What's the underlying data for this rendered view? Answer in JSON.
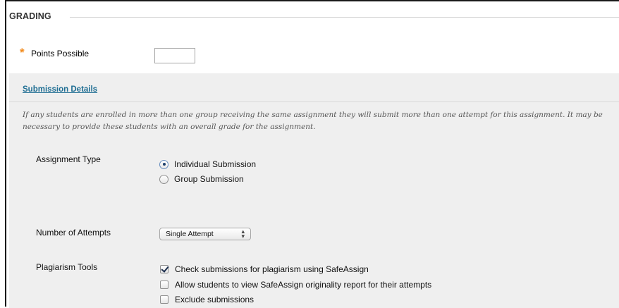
{
  "section": {
    "title": "GRADING"
  },
  "points": {
    "label": "Points Possible",
    "value": "",
    "required_marker": "*"
  },
  "submission_details": {
    "title": "Submission Details",
    "note": "If any students are enrolled in more than one group receiving the same assignment they will submit more than one attempt for this assignment. It may be necessary to provide these students with an overall grade for the assignment."
  },
  "assignment_type": {
    "label": "Assignment Type",
    "options": [
      {
        "label": "Individual Submission",
        "selected": true
      },
      {
        "label": "Group Submission",
        "selected": false
      }
    ]
  },
  "attempts": {
    "label": "Number of Attempts",
    "selected": "Single Attempt"
  },
  "plagiarism": {
    "label": "Plagiarism Tools",
    "options": [
      {
        "label": "Check submissions for plagiarism using SafeAssign",
        "checked": true
      },
      {
        "label": "Allow students to view SafeAssign originality report for their attempts",
        "checked": false
      },
      {
        "label": "Exclude submissions",
        "checked": false
      }
    ]
  },
  "colors": {
    "required_star": "#f28c1f",
    "link": "#1f6e93",
    "panel_bg": "#efefef"
  },
  "icons": {
    "required": "asterisk-icon",
    "select_arrows": "up-down-arrows-icon"
  }
}
